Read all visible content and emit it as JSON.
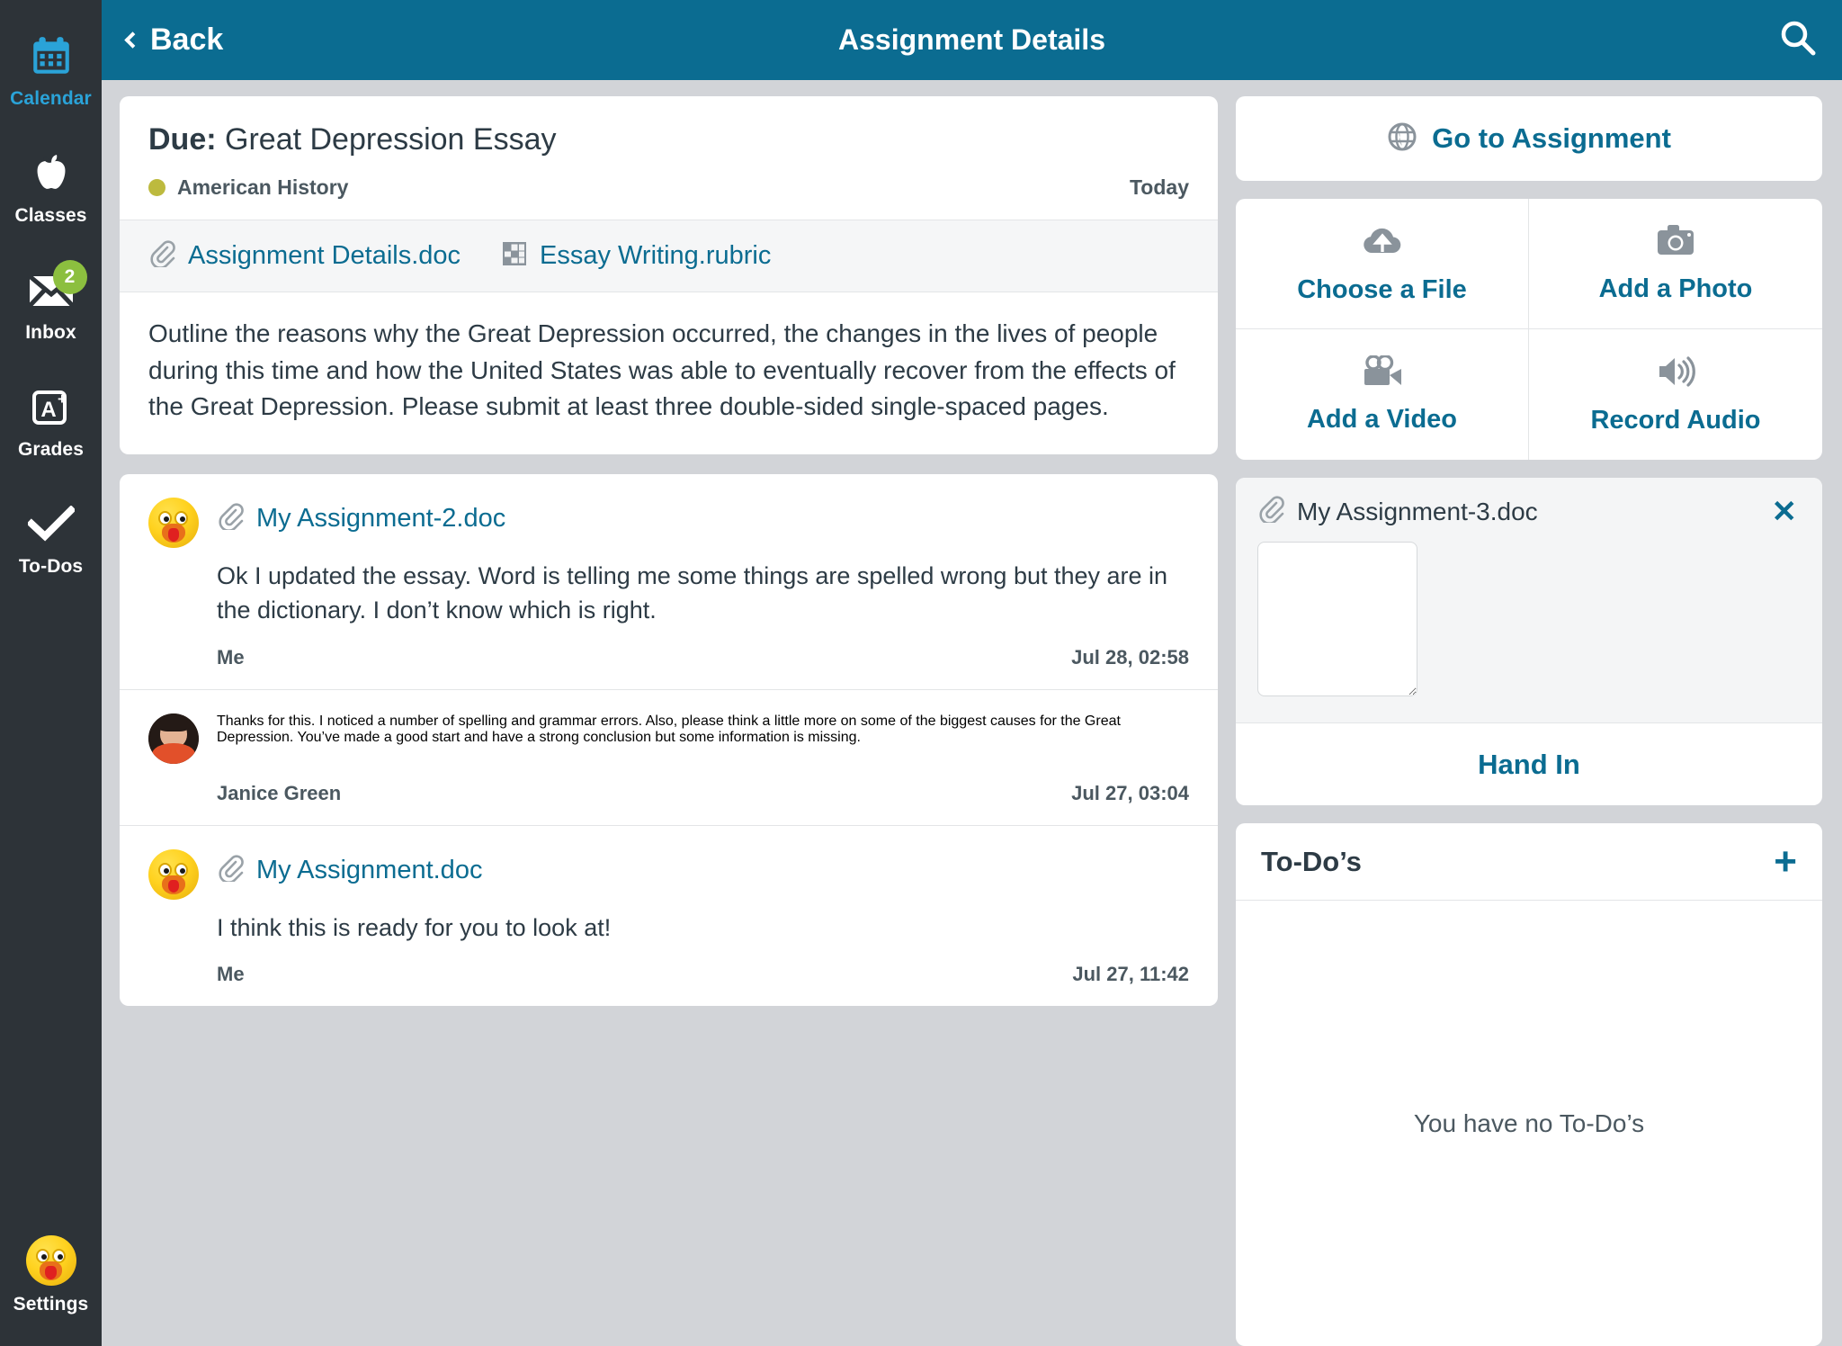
{
  "app": {
    "accent_teal": "#0b6c91",
    "rail_bg": "#2d3338",
    "badge_green": "#8cbf3f",
    "course_dot_color": "#bdba3e",
    "page_bg": "#d2d4d8"
  },
  "sidebar": {
    "items": [
      {
        "label": "Calendar",
        "icon": "calendar-icon",
        "active": true,
        "badge": ""
      },
      {
        "label": "Classes",
        "icon": "apple-icon",
        "active": false,
        "badge": ""
      },
      {
        "label": "Inbox",
        "icon": "envelope-icon",
        "active": false,
        "badge": "2"
      },
      {
        "label": "Grades",
        "icon": "a-plus-icon",
        "active": false,
        "badge": ""
      },
      {
        "label": "To-Dos",
        "icon": "checkmark-icon",
        "active": false,
        "badge": ""
      }
    ],
    "settings": {
      "label": "Settings",
      "icon": "user-avatar-icon"
    }
  },
  "header": {
    "back_label": "Back",
    "title": "Assignment Details",
    "search_icon": "search-icon"
  },
  "assignment": {
    "due_prefix": "Due:",
    "title": "Great Depression Essay",
    "course": "American History",
    "due_when": "Today",
    "attachments": [
      {
        "name": "Assignment Details.doc",
        "icon": "paperclip-icon"
      },
      {
        "name": "Essay Writing.rubric",
        "icon": "rubric-grid-icon"
      }
    ],
    "description": "Outline the reasons why the Great Depression occurred, the changes in the lives of people during this time and how the United States was able to eventually recover from the effects of the Great Depression. Please submit at least three double-sided single-spaced pages."
  },
  "comments": [
    {
      "avatar": "bird",
      "attachment": "My Assignment-2.doc",
      "text": "Ok I updated the essay. Word is telling me some things are spelled wrong but they are in the dictionary. I don’t know which is right.",
      "author": "Me",
      "time": "Jul 28, 02:58"
    },
    {
      "avatar": "person",
      "attachment": "",
      "text": "Thanks for this. I noticed a number of spelling and grammar errors. Also, please think a little more on some of the biggest causes for the Great Depression. You’ve made a good start and have a strong conclusion but some information is missing.",
      "author": "Janice Green",
      "time": "Jul 27, 03:04"
    },
    {
      "avatar": "bird",
      "attachment": "My Assignment.doc",
      "text": "I think this is ready for you to look at!",
      "author": "Me",
      "time": "Jul 27, 11:42"
    }
  ],
  "side": {
    "go_to_assignment": {
      "label": "Go to Assignment",
      "icon": "globe-icon"
    },
    "submit_options": [
      {
        "label": "Choose a File",
        "icon": "cloud-upload-icon"
      },
      {
        "label": "Add a Photo",
        "icon": "camera-icon"
      },
      {
        "label": "Add a Video",
        "icon": "video-camera-icon"
      },
      {
        "label": "Record Audio",
        "icon": "speaker-audio-icon"
      }
    ],
    "upload": {
      "file_name": "My Assignment-3.doc",
      "file_icon": "paperclip-icon",
      "close_icon": "close-x-icon",
      "close_label": "✕",
      "comment_placeholder": "",
      "comment_value": "",
      "hand_in_label": "Hand In"
    },
    "todos": {
      "title": "To-Do’s",
      "add_label": "+",
      "add_icon": "plus-icon",
      "empty_text": "You have no To-Do’s"
    }
  }
}
